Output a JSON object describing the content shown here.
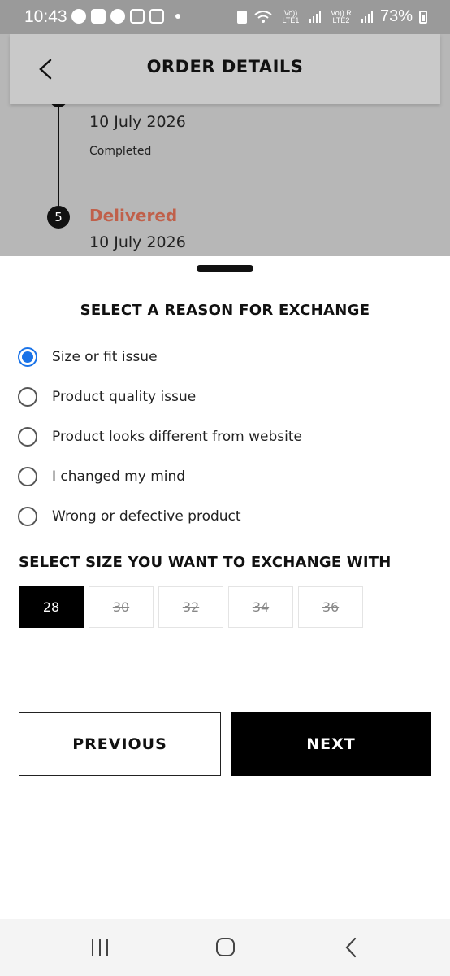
{
  "status_bar": {
    "time": "10:43",
    "lte1": "Vo)) LTE1",
    "lte2": "Vo)) R LTE2",
    "battery": "73%"
  },
  "header": {
    "title": "ORDER DETAILS",
    "back_icon": "chevron-left-icon"
  },
  "timeline": {
    "previous_step": {
      "date": "10 July 2026",
      "status": "Completed"
    },
    "current_step": {
      "number": "5",
      "title": "Delivered",
      "date": "10 July 2026",
      "title_color": "#c0604a"
    }
  },
  "sheet": {
    "title": "SELECT A REASON FOR EXCHANGE",
    "reasons": [
      {
        "label": "Size or fit issue",
        "selected": true
      },
      {
        "label": "Product quality issue",
        "selected": false
      },
      {
        "label": "Product looks different from website",
        "selected": false
      },
      {
        "label": "I changed my mind",
        "selected": false
      },
      {
        "label": "Wrong or defective product",
        "selected": false
      }
    ],
    "size_title": "SELECT SIZE YOU WANT TO EXCHANGE WITH",
    "sizes": [
      {
        "label": "28",
        "selected": true,
        "available": true
      },
      {
        "label": "30",
        "selected": false,
        "available": false
      },
      {
        "label": "32",
        "selected": false,
        "available": false
      },
      {
        "label": "34",
        "selected": false,
        "available": false
      },
      {
        "label": "36",
        "selected": false,
        "available": false
      }
    ],
    "previous_label": "PREVIOUS",
    "next_label": "NEXT"
  },
  "nav": {
    "recents_icon": "recents-icon",
    "home_icon": "home-icon",
    "back_icon": "back-icon"
  },
  "colors": {
    "accent_radio": "#1a73e8",
    "delivered": "#c0604a",
    "primary_button": "#000000"
  }
}
